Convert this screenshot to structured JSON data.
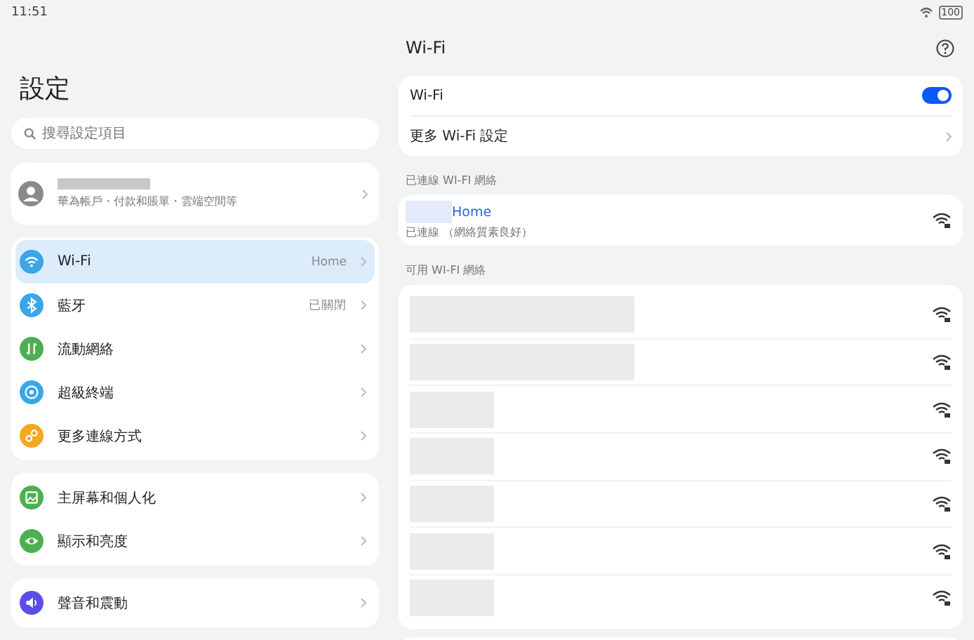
{
  "status_bar": {
    "time": "11:51",
    "battery": "100"
  },
  "sidebar": {
    "title": "設定",
    "search": {
      "placeholder": "搜尋設定項目"
    },
    "account": {
      "subtitle": "華為帳戶・付款和賬單・雲端空間等"
    },
    "groups": [
      {
        "items": [
          {
            "kind": "wifi",
            "label": "Wi-Fi",
            "value": "Home",
            "color": "#3aa6e8",
            "selected": true
          },
          {
            "kind": "bluetooth",
            "label": "藍牙",
            "value": "已關閉",
            "color": "#3aa6e8",
            "selected": false
          },
          {
            "kind": "mobile",
            "label": "流動網絡",
            "color": "#4cb050",
            "selected": false
          },
          {
            "kind": "device",
            "label": "超級終端",
            "color": "#3aa6e8",
            "selected": false
          },
          {
            "kind": "link",
            "label": "更多連線方式",
            "color": "#f5a623",
            "selected": false
          }
        ]
      },
      {
        "items": [
          {
            "kind": "image",
            "label": "主屏幕和個人化",
            "color": "#4cb050",
            "selected": false
          },
          {
            "kind": "eye",
            "label": "顯示和亮度",
            "color": "#4cb050",
            "selected": false
          }
        ]
      },
      {
        "items": [
          {
            "kind": "sound",
            "label": "聲音和震動",
            "color": "#5b4ee8",
            "selected": false
          }
        ]
      }
    ]
  },
  "detail": {
    "title": "Wi-Fi",
    "settings": [
      {
        "kind": "toggle",
        "label": "Wi-Fi",
        "on": true
      },
      {
        "kind": "link",
        "label": "更多 Wi-Fi 設定"
      }
    ],
    "connected_header": "已連線 WI-FI 網絡",
    "connected": {
      "name": "Home",
      "status": "已連線 （網絡質素良好）",
      "locked": true
    },
    "available_header": "可用 WI-FI 網絡",
    "available": [
      {
        "locked": true
      },
      {
        "locked": true
      },
      {
        "locked": true
      },
      {
        "locked": true
      },
      {
        "locked": true
      },
      {
        "locked": true
      },
      {
        "locked": true
      }
    ]
  }
}
